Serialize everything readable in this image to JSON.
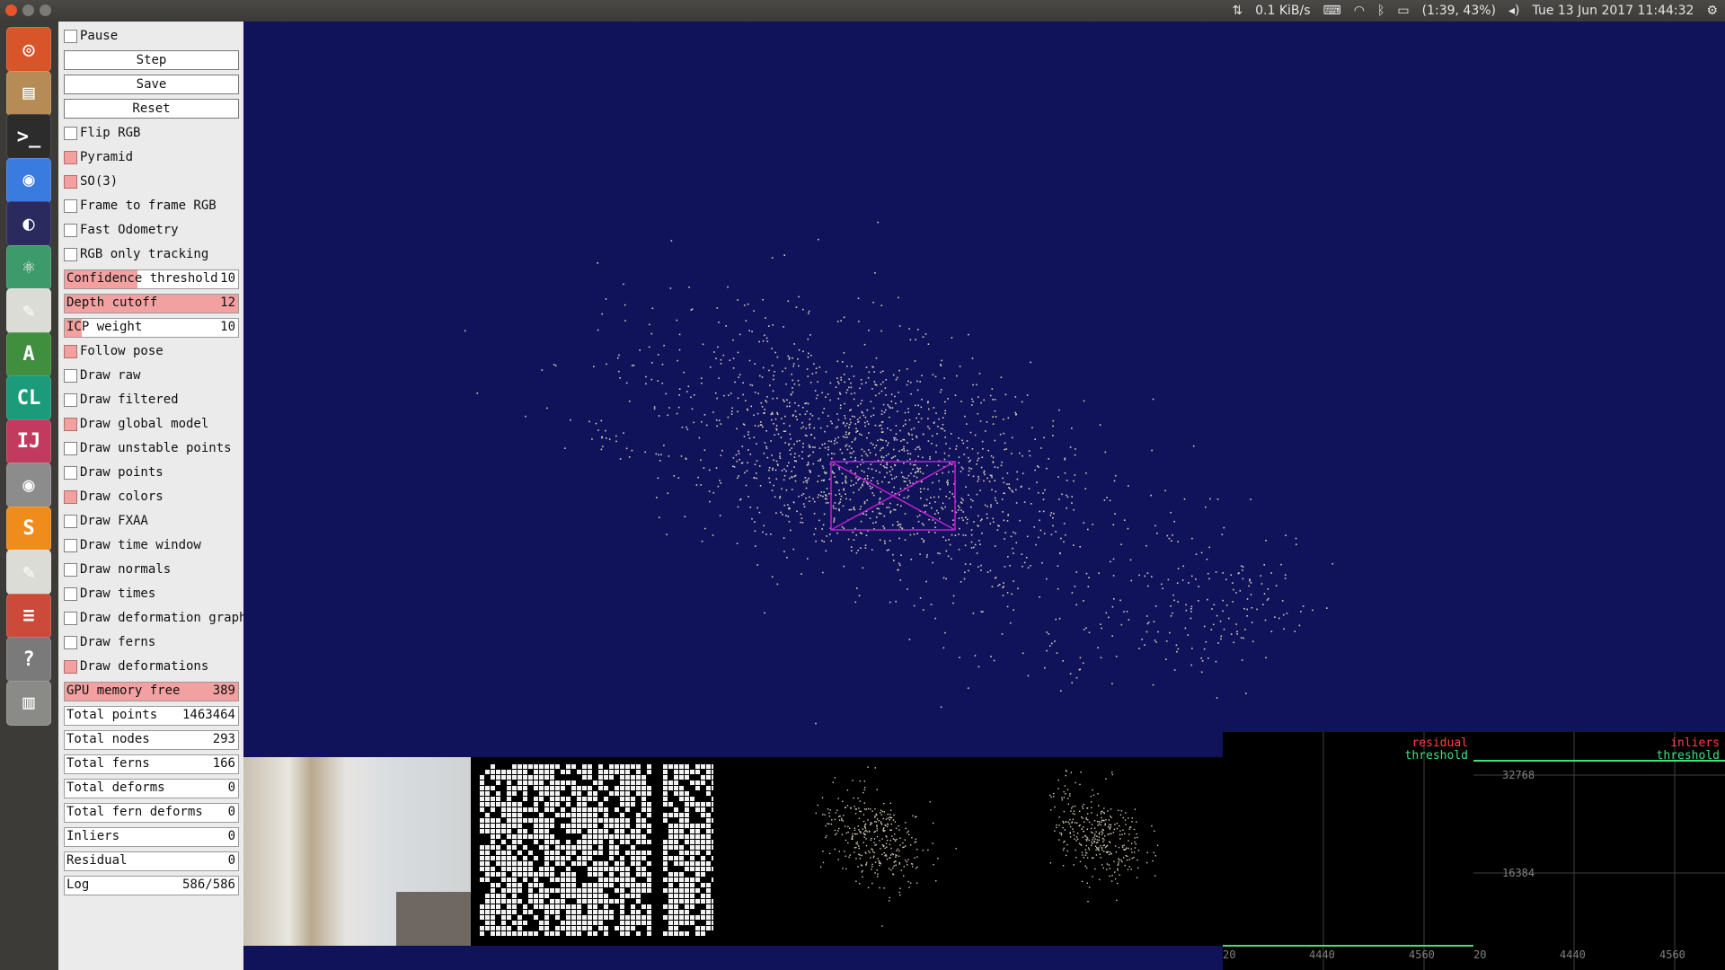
{
  "topbar": {
    "network_speed": "0.1 KiB/s",
    "battery": "(1:39, 43%)",
    "datetime": "Tue 13 Jun 2017 11:44:32",
    "icons": [
      "network-transfer-icon",
      "keyboard-icon",
      "wifi-icon",
      "bluetooth-icon",
      "battery-icon",
      "volume-icon",
      "settings-gear-icon"
    ]
  },
  "launcher": {
    "items": [
      {
        "name": "ubuntu-dash-icon",
        "glyph": "◎",
        "color": "#d8552a"
      },
      {
        "name": "files-icon",
        "glyph": "▤",
        "color": "#b78b55"
      },
      {
        "name": "terminal-icon",
        "glyph": ">_",
        "color": "#2c2c2c"
      },
      {
        "name": "chrome-icon",
        "glyph": "◉",
        "color": "#3a7be0"
      },
      {
        "name": "eclipse-icon",
        "glyph": "◐",
        "color": "#2b2a5e"
      },
      {
        "name": "atom-icon",
        "glyph": "⚛",
        "color": "#3d9a6a"
      },
      {
        "name": "text-editor-icon",
        "glyph": "✎",
        "color": "#dcdcd6"
      },
      {
        "name": "android-studio-icon",
        "glyph": "A",
        "color": "#3f8f3f"
      },
      {
        "name": "clion-icon",
        "glyph": "CL",
        "color": "#1c9b7a"
      },
      {
        "name": "intellij-icon",
        "glyph": "IJ",
        "color": "#c23b5e"
      },
      {
        "name": "eye-app-icon",
        "glyph": "◉",
        "color": "#8c8c8c"
      },
      {
        "name": "sublime-text-icon",
        "glyph": "S",
        "color": "#f08c1c"
      },
      {
        "name": "gedit-icon",
        "glyph": "✎",
        "color": "#dcdcd6"
      },
      {
        "name": "stacked-apps-icon",
        "glyph": "≡",
        "color": "#cc4a3a"
      },
      {
        "name": "help-icon",
        "glyph": "?",
        "color": "#7a7a7a"
      },
      {
        "name": "trash-icon",
        "glyph": "▥",
        "color": "#8a8a86"
      }
    ]
  },
  "panel": {
    "pause": {
      "label": "Pause",
      "checked": false
    },
    "step_button": "Step",
    "save_button": "Save",
    "reset_button": "Reset",
    "flip_rgb": {
      "label": "Flip RGB",
      "checked": false
    },
    "pyramid": {
      "label": "Pyramid",
      "checked": true
    },
    "so3": {
      "label": "SO(3)",
      "checked": true
    },
    "frame_to_frame_rgb": {
      "label": "Frame to frame RGB",
      "checked": false
    },
    "fast_odometry": {
      "label": "Fast Odometry",
      "checked": false
    },
    "rgb_only_tracking": {
      "label": "RGB only tracking",
      "checked": false
    },
    "confidence_threshold": {
      "label": "Confidence threshold",
      "value": "10",
      "fraction": 0.42
    },
    "depth_cutoff": {
      "label": "Depth cutoff",
      "value": "12",
      "fraction": 1.0
    },
    "icp_weight": {
      "label": "ICP weight",
      "value": "10",
      "fraction": 0.1
    },
    "follow_pose": {
      "label": "Follow pose",
      "checked": true
    },
    "draw_raw": {
      "label": "Draw raw",
      "checked": false
    },
    "draw_filtered": {
      "label": "Draw filtered",
      "checked": false
    },
    "draw_global_model": {
      "label": "Draw global model",
      "checked": true
    },
    "draw_unstable_points": {
      "label": "Draw unstable points",
      "checked": false
    },
    "draw_points": {
      "label": "Draw points",
      "checked": false
    },
    "draw_colors": {
      "label": "Draw colors",
      "checked": true
    },
    "draw_fxaa": {
      "label": "Draw FXAA",
      "checked": false
    },
    "draw_time_window": {
      "label": "Draw time window",
      "checked": false
    },
    "draw_normals": {
      "label": "Draw normals",
      "checked": false
    },
    "draw_times": {
      "label": "Draw times",
      "checked": false
    },
    "draw_deformation_graph": {
      "label": "Draw deformation graph",
      "checked": false
    },
    "draw_ferns": {
      "label": "Draw ferns",
      "checked": false
    },
    "draw_deformations": {
      "label": "Draw deformations",
      "checked": true
    },
    "gpu_memory_free": {
      "label": "GPU memory free",
      "value": "389",
      "fraction": 1.0
    },
    "total_points": {
      "label": "Total points",
      "value": "1463464"
    },
    "total_nodes": {
      "label": "Total nodes",
      "value": "293"
    },
    "total_ferns": {
      "label": "Total ferns",
      "value": "166"
    },
    "total_deforms": {
      "label": "Total deforms",
      "value": "0"
    },
    "total_fern_deforms": {
      "label": "Total fern deforms",
      "value": "0"
    },
    "inliers": {
      "label": "Inliers",
      "value": "0"
    },
    "residual": {
      "label": "Residual",
      "value": "0"
    },
    "log": {
      "label": "Log",
      "value": "586/586"
    }
  },
  "plots": {
    "residual_plot": {
      "legend_residual": "residual",
      "legend_threshold": "threshold",
      "y_ticks": [],
      "x_ticks": [
        "20",
        "4440",
        "4560"
      ]
    },
    "inliers_plot": {
      "legend_inliers": "inliers",
      "legend_threshold": "threshold",
      "y_ticks": [
        "32768",
        "16384"
      ],
      "x_ticks": [
        "20",
        "4440",
        "4560"
      ]
    }
  },
  "colors": {
    "background": "#10125a",
    "panel": "#ebebeb",
    "checked": "#f2a0a0",
    "camera_frustum": "#c020d0",
    "points": "#d8cfb8"
  }
}
